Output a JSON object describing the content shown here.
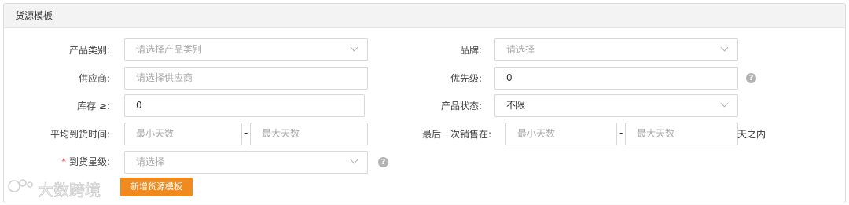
{
  "panel": {
    "title": "货源模板"
  },
  "form": {
    "category": {
      "label": "产品类别:",
      "placeholder": "请选择产品类别"
    },
    "brand": {
      "label": "品牌:",
      "placeholder": "请选择"
    },
    "supplier": {
      "label": "供应商:",
      "placeholder": "请选择供应商"
    },
    "priority": {
      "label": "优先级:",
      "value": "0"
    },
    "stock": {
      "label": "库存 ≥:",
      "value": "0"
    },
    "status": {
      "label": "产品状态:",
      "value": "不限"
    },
    "avg_arrival": {
      "label": "平均到货时间:",
      "min_placeholder": "最小天数",
      "max_placeholder": "最大天数",
      "separator": "-"
    },
    "last_sale": {
      "label": "最后一次销售在:",
      "min_placeholder": "最小天数",
      "max_placeholder": "最大天数",
      "separator": "-",
      "suffix": "天之内"
    },
    "arrival_level": {
      "required_mark": "*",
      "label": "到货星级:",
      "placeholder": "请选择"
    },
    "help_glyph": "?"
  },
  "actions": {
    "add_template_label": "新增货源模板"
  },
  "watermark": {
    "text": "大数跨境"
  }
}
